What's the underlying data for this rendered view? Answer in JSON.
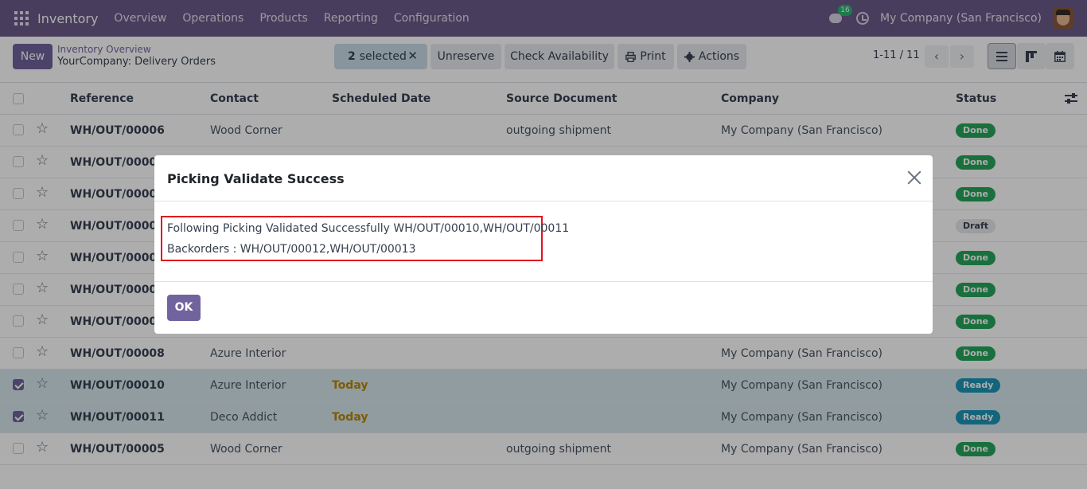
{
  "topbar": {
    "app_name": "Inventory",
    "menu": [
      "Overview",
      "Operations",
      "Products",
      "Reporting",
      "Configuration"
    ],
    "messages_count": "16",
    "company": "My Company (San Francisco)"
  },
  "controlpanel": {
    "new_label": "New",
    "breadcrumb_parent": "Inventory Overview",
    "breadcrumb_current": "YourCompany: Delivery Orders",
    "selected_count": "2",
    "selected_label": "selected",
    "unreserve_label": "Unreserve",
    "check_availability_label": "Check Availability",
    "print_label": "Print",
    "actions_label": "Actions",
    "pager": "1-11 / 11"
  },
  "table": {
    "headers": {
      "reference": "Reference",
      "contact": "Contact",
      "scheduled_date": "Scheduled Date",
      "source_document": "Source Document",
      "company": "Company",
      "status": "Status"
    },
    "rows": [
      {
        "reference": "WH/OUT/00006",
        "contact": "Wood Corner",
        "scheduled": "",
        "source": "outgoing shipment",
        "company": "My Company (San Francisco)",
        "status": "Done",
        "checked": false
      },
      {
        "reference": "WH/OUT/00002",
        "contact": "",
        "scheduled": "",
        "source": "",
        "company": "",
        "status": "Done",
        "checked": false
      },
      {
        "reference": "WH/OUT/00007",
        "contact": "",
        "scheduled": "",
        "source": "",
        "company": "",
        "status": "Done",
        "checked": false
      },
      {
        "reference": "WH/OUT/00003",
        "contact": "",
        "scheduled": "",
        "source": "",
        "company": "",
        "status": "Draft",
        "checked": false
      },
      {
        "reference": "WH/OUT/00001",
        "contact": "",
        "scheduled": "",
        "source": "",
        "company": "",
        "status": "Done",
        "checked": false
      },
      {
        "reference": "WH/OUT/00004",
        "contact": "",
        "scheduled": "",
        "source": "",
        "company": "",
        "status": "Done",
        "checked": false
      },
      {
        "reference": "WH/OUT/00009",
        "contact": "",
        "scheduled": "",
        "source": "",
        "company": "",
        "status": "Done",
        "checked": false
      },
      {
        "reference": "WH/OUT/00008",
        "contact": "Azure Interior",
        "scheduled": "",
        "source": "",
        "company": "My Company (San Francisco)",
        "status": "Done",
        "checked": false
      },
      {
        "reference": "WH/OUT/00010",
        "contact": "Azure Interior",
        "scheduled": "Today",
        "source": "",
        "company": "My Company (San Francisco)",
        "status": "Ready",
        "checked": true
      },
      {
        "reference": "WH/OUT/00011",
        "contact": "Deco Addict",
        "scheduled": "Today",
        "source": "",
        "company": "My Company (San Francisco)",
        "status": "Ready",
        "checked": true
      },
      {
        "reference": "WH/OUT/00005",
        "contact": "Wood Corner",
        "scheduled": "",
        "source": "outgoing shipment",
        "company": "My Company (San Francisco)",
        "status": "Done",
        "checked": false
      }
    ]
  },
  "modal": {
    "title": "Picking Validate Success",
    "line1": "Following Picking Validated Successfully WH/OUT/00010,WH/OUT/00011",
    "line2": "Backorders : WH/OUT/00012,WH/OUT/00013",
    "ok_label": "OK"
  },
  "colors": {
    "navbar": "#6b5b8a",
    "primary": "#71639e",
    "done": "#26a65b",
    "ready": "#1d95b7",
    "today": "#b8870a",
    "highlight": "#e0141e"
  }
}
